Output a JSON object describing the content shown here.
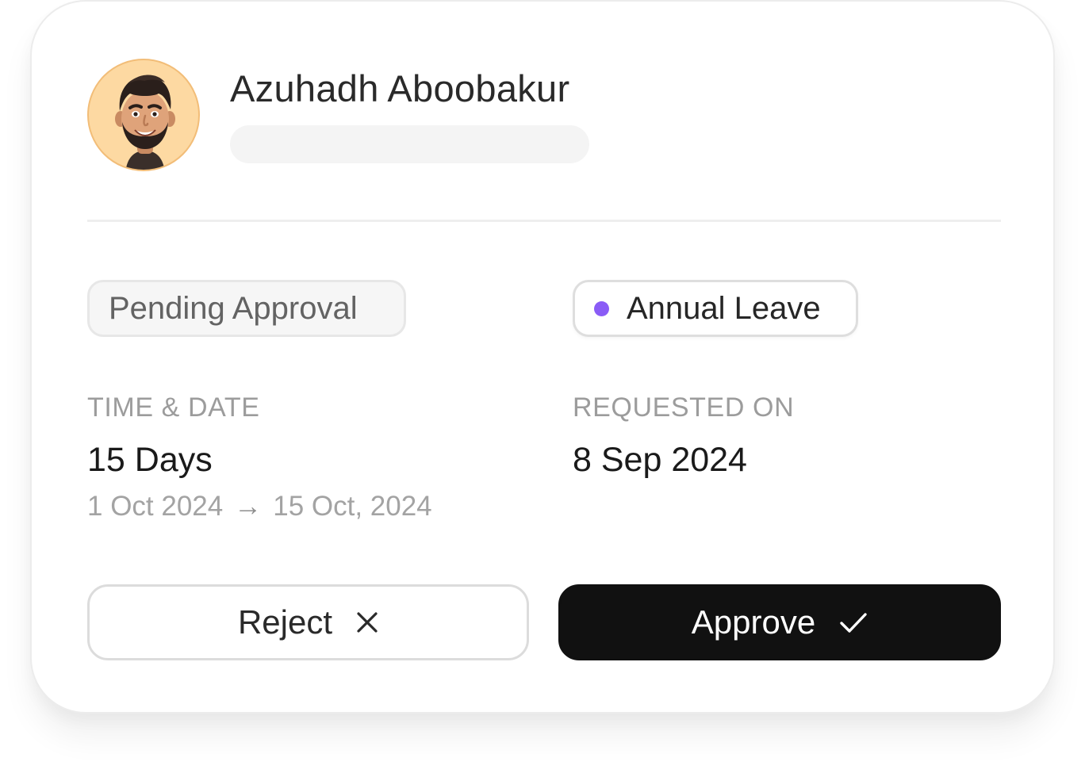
{
  "request_card": {
    "employee": {
      "name": "Azuhadh Aboobakur",
      "avatar_icon": "memoji-avatar-icon",
      "avatar_bg": "#fdd9a2"
    },
    "status_badge": "Pending Approval",
    "leave_type": {
      "label": "Annual Leave",
      "dot_color": "#8a5cf6"
    },
    "time_date": {
      "label": "TIME & DATE",
      "duration": "15 Days",
      "start": "1 Oct 2024",
      "arrow": "→",
      "end": "15 Oct, 2024"
    },
    "requested_on": {
      "label": "REQUESTED ON",
      "date": "8 Sep 2024"
    },
    "actions": {
      "reject_label": "Reject",
      "reject_icon": "close-icon",
      "approve_label": "Approve",
      "approve_icon": "check-icon",
      "approve_bg": "#111111"
    }
  }
}
